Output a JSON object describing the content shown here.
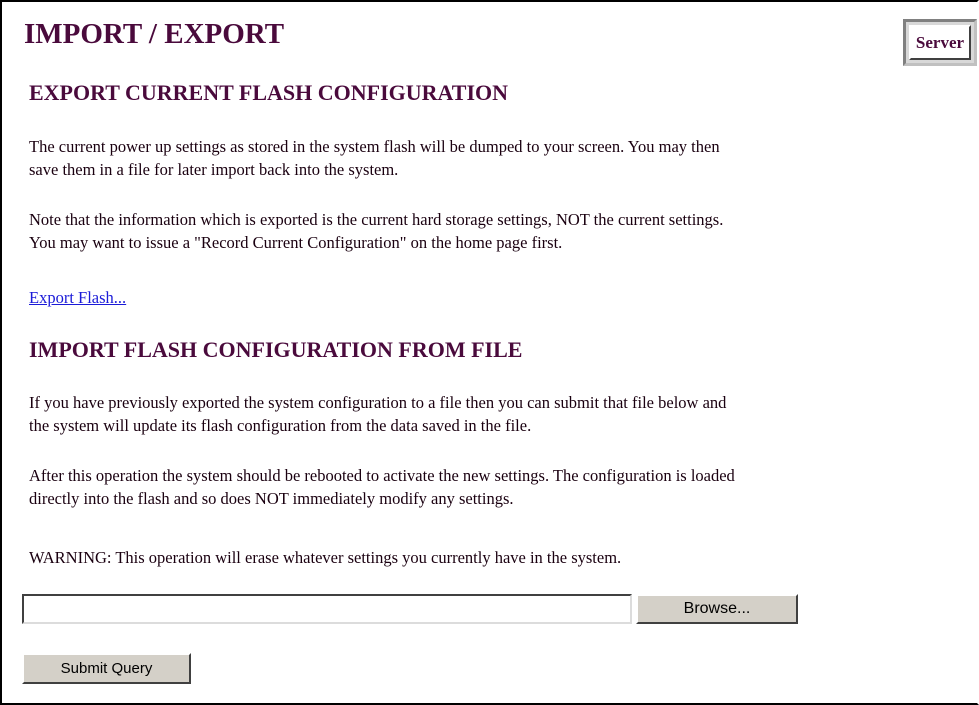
{
  "page": {
    "title": "IMPORT / EXPORT",
    "server_button_label": "Server"
  },
  "export_section": {
    "heading": "EXPORT CURRENT FLASH CONFIGURATION",
    "paragraph_1_line_1": "The current power up settings as stored in the system flash will be dumped to your screen. You may then",
    "paragraph_1_line_2": "save them in a file for later import back into the system.",
    "paragraph_2_line_1": "Note that the information which is exported is the current hard storage settings, NOT the current settings.",
    "paragraph_2_line_2": "You may want to issue a \"Record Current Configuration\" on the home page first.",
    "export_link": "Export Flash..."
  },
  "import_section": {
    "heading": "IMPORT FLASH CONFIGURATION FROM FILE",
    "paragraph_1_line_1": "If you have previously exported the system configuration to a file then you can submit that file below and",
    "paragraph_1_line_2": "the system will update its flash configuration from the data saved in the file.",
    "paragraph_2_line_1": "After this operation the system should be rebooted to activate the new settings. The configuration is loaded",
    "paragraph_2_line_2": "directly into the flash and so does NOT immediately modify any settings.",
    "warning": "WARNING: This operation will erase whatever settings you currently have in the system.",
    "file_input_value": "",
    "browse_label": "Browse...",
    "submit_label": "Submit Query"
  }
}
